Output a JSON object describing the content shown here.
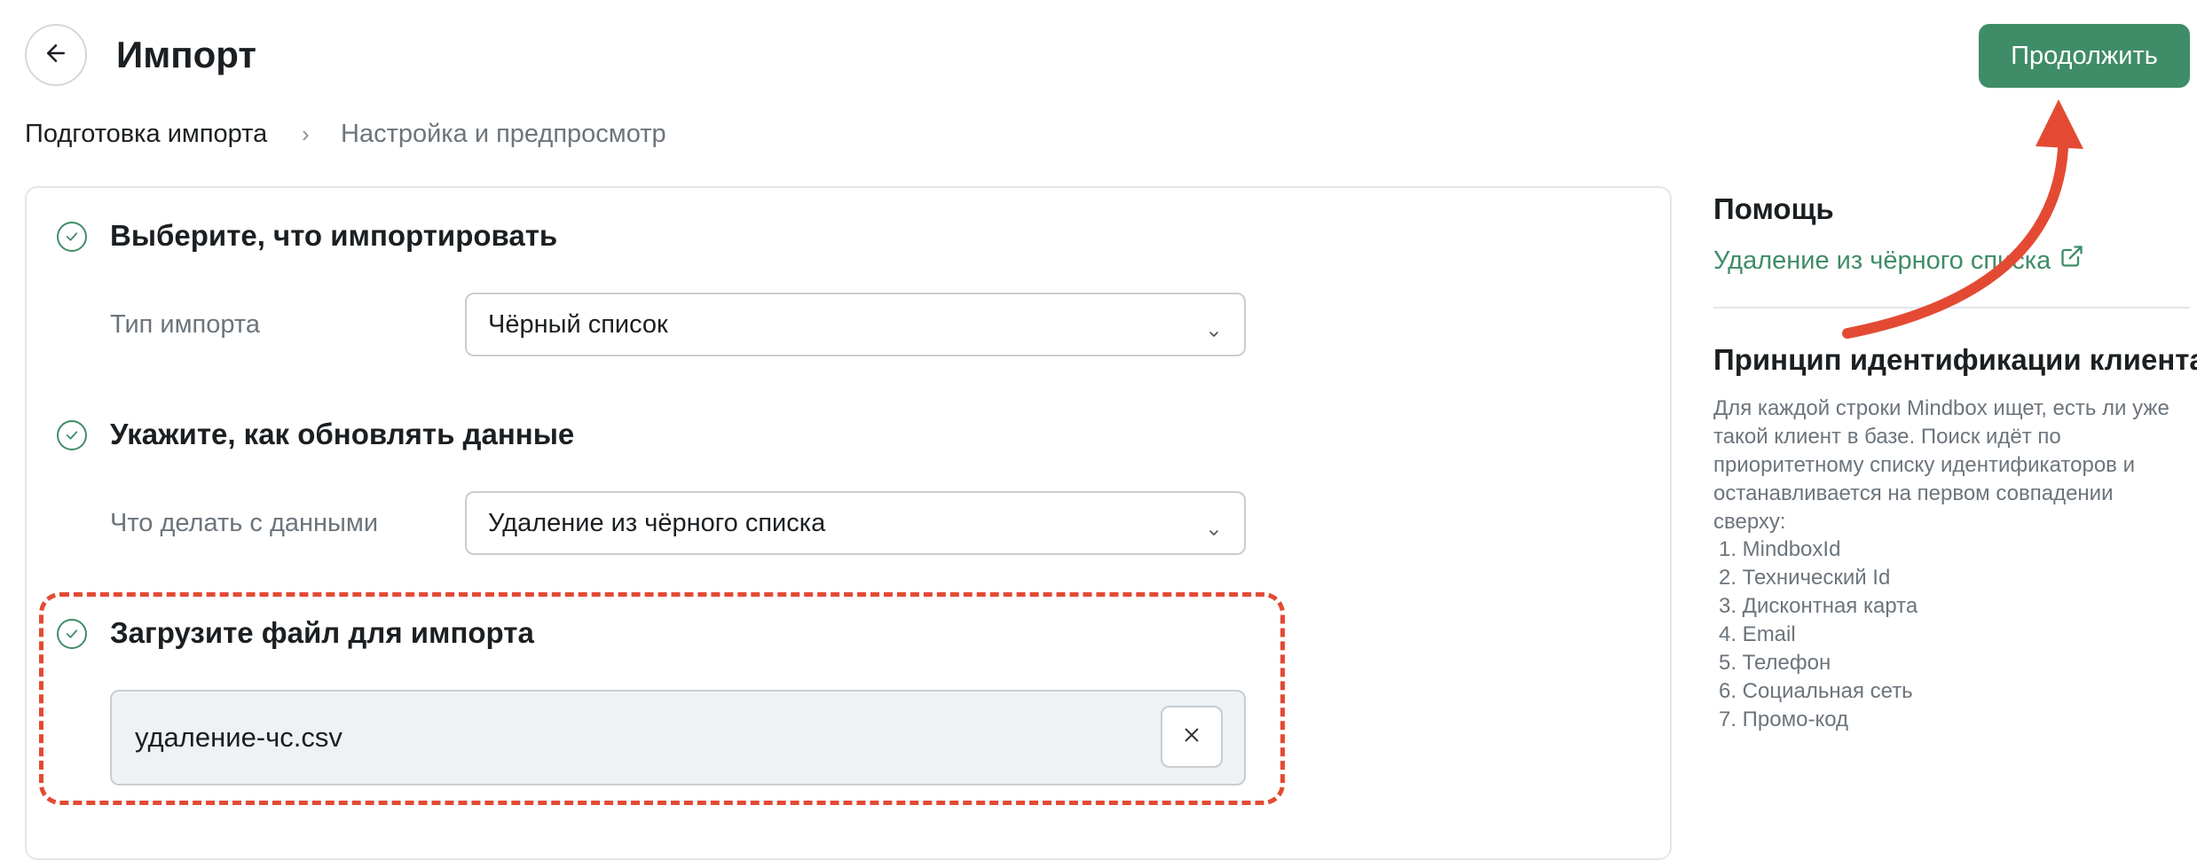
{
  "header": {
    "title": "Импорт",
    "continue_label": "Продолжить"
  },
  "breadcrumb": {
    "step1": "Подготовка импорта",
    "separator": "›",
    "step2": "Настройка и предпросмотр"
  },
  "sections": [
    {
      "title": "Выберите, что импортировать",
      "field_label": "Тип импорта",
      "field_value": "Чёрный список"
    },
    {
      "title": "Укажите, как обновлять данные",
      "field_label": "Что делать с данными",
      "field_value": "Удаление из чёрного списка"
    },
    {
      "title": "Загрузите файл для импорта",
      "file_name": "удаление-чс.csv"
    }
  ],
  "help": {
    "title": "Помощь",
    "link_text": "Удаление из чёрного списка",
    "principle_title": "Принцип идентификации клиента",
    "principle_text": "Для каждой строки Mindbox ищет, есть ли уже такой клиент в базе. Поиск идёт по приоритетному списку идентификаторов и останавливается на первом совпадении сверху:",
    "identifiers": [
      "1. MindboxId",
      "2. Технический Id",
      "3. Дисконтная карта",
      "4. Email",
      "5. Телефон",
      "6. Социальная сеть",
      "7. Промо-код"
    ]
  },
  "icons": {
    "back": "arrow-left-icon",
    "check": "check-circle-icon",
    "chevron": "chevron-down-icon",
    "close": "close-icon",
    "external": "external-link-icon"
  },
  "colors": {
    "accent": "#3f8c68",
    "annotation": "#e44a33",
    "text_primary": "#1b1f22",
    "text_secondary": "#6c747c",
    "file_bg": "#eef2f4"
  }
}
